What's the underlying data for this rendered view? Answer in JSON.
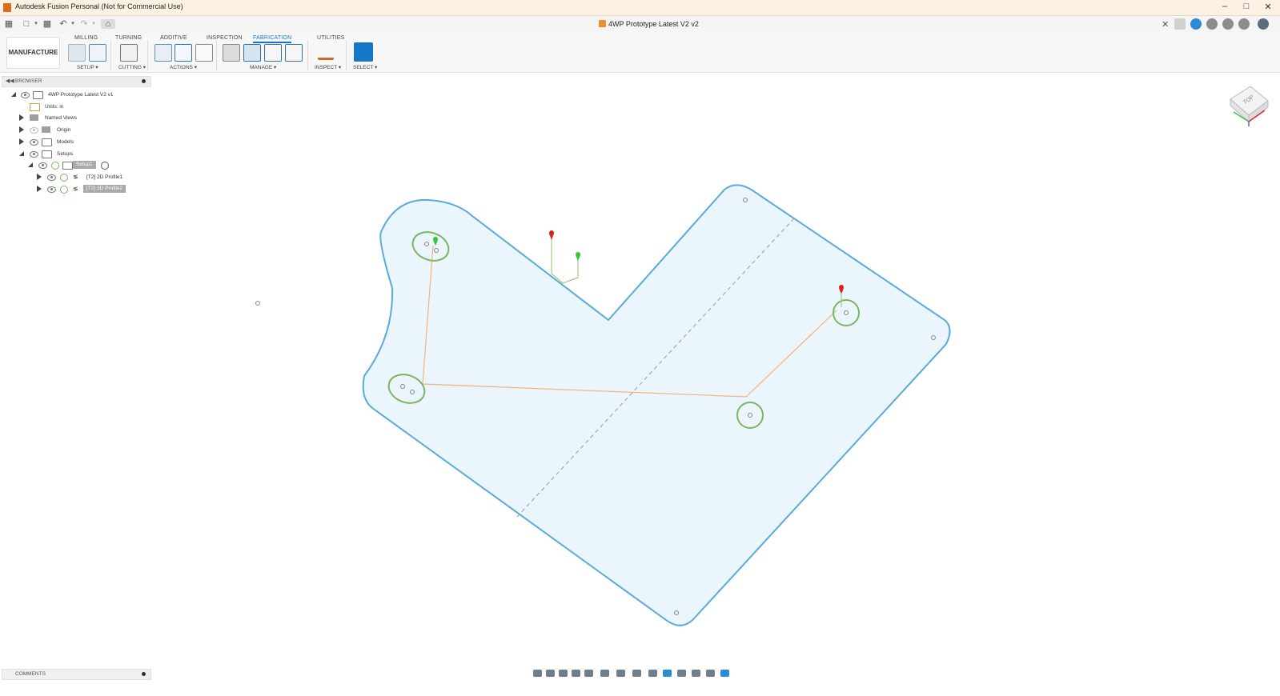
{
  "app": {
    "title": "Autodesk Fusion Personal (Not for Commercial Use)",
    "document_tab": "4WP Prototype Latest V2 v2"
  },
  "ribbon": {
    "workspace": "MANUFACTURE",
    "tabs": [
      "MILLING",
      "TURNING",
      "ADDITIVE",
      "INSPECTION",
      "FABRICATION",
      "UTILITIES"
    ],
    "active_tab": "FABRICATION",
    "groups": {
      "setup": "SETUP",
      "cutting": "CUTTING",
      "actions": "ACTIONS",
      "manage": "MANAGE",
      "inspect": "INSPECT",
      "select": "SELECT"
    }
  },
  "browser": {
    "title": "BROWSER",
    "root": "4WP Prototype Latest V2 v1",
    "units": "Units: in",
    "named_views": "Named Views",
    "origin": "Origin",
    "models": "Models",
    "setups": "Setups",
    "setup1": "Setup1",
    "op1": "[T2] 2D Profile1",
    "op2": "[T2] 2D Profile2"
  },
  "comments": {
    "title": "COMMENTS"
  },
  "viewcube": {
    "face": "TOP"
  },
  "colors": {
    "accent": "#1677c8",
    "part_outline": "#5aa9dc",
    "part_fill": "#eaf5fc",
    "toolpath": "#f0b37e",
    "hole": "#7bb662"
  },
  "icons": [
    "grid-menu-icon",
    "file-icon",
    "save-icon",
    "undo-icon",
    "redo-icon",
    "home-icon",
    "close-icon"
  ]
}
